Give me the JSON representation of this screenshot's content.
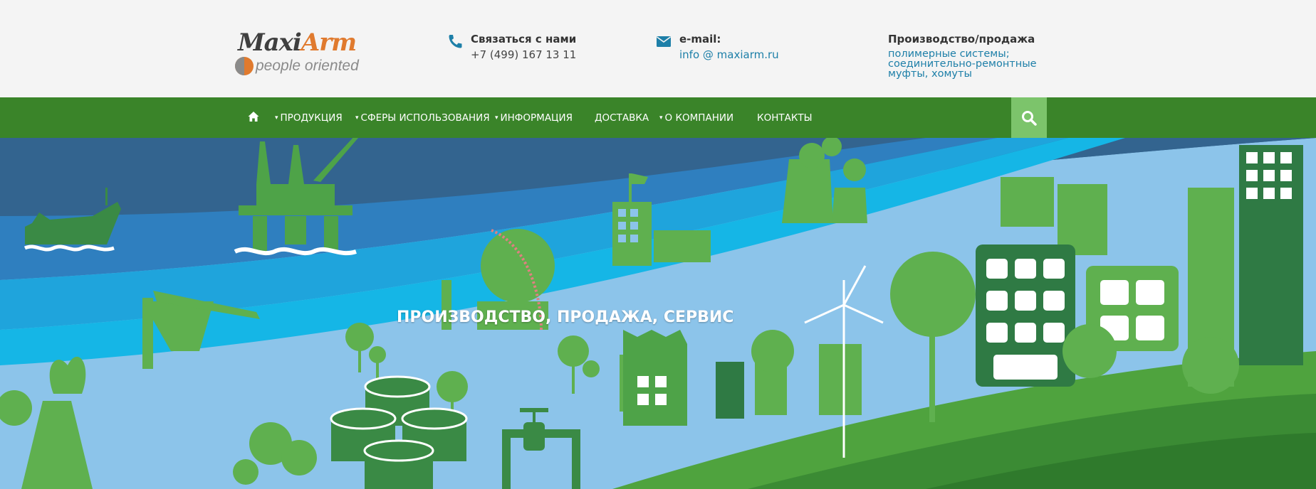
{
  "logo": {
    "brand_dark": "Maxi",
    "brand_accent": "Arm",
    "tagline": "people oriented"
  },
  "contacts": [
    {
      "icon": "phone-icon",
      "title": "Связаться с нами",
      "value": "+7 (499) 167 13 11"
    },
    {
      "icon": "envelope-icon",
      "title": "e-mail:",
      "value": "info @ maxiarm.ru"
    },
    {
      "title": "Производство/продажа",
      "lines": [
        "полимерные системы;",
        "соединительно-ремонтные",
        "муфты, хомуты"
      ]
    }
  ],
  "nav": {
    "home_icon": "home-icon",
    "items": [
      {
        "label": "ПРОДУКЦИЯ",
        "dropdown": true
      },
      {
        "label": "СФЕРЫ ИСПОЛЬЗОВАНИЯ",
        "dropdown": true
      },
      {
        "label": "ИНФОРМАЦИЯ",
        "dropdown": true
      },
      {
        "label": "ДОСТАВКА",
        "dropdown": false
      },
      {
        "label": "О КОМПАНИИ",
        "dropdown": true
      },
      {
        "label": "КОНТАКТЫ",
        "dropdown": false
      }
    ],
    "search_icon": "search-icon",
    "caret": "▾"
  },
  "hero": {
    "title": "ПРОИЗВОДСТВО, ПРОДАЖА, СЕРВИС"
  },
  "colors": {
    "nav_bg": "#3a8429",
    "search_bg": "#7cc46b",
    "link": "#1d7fa8",
    "logo_accent": "#e07a2e"
  }
}
